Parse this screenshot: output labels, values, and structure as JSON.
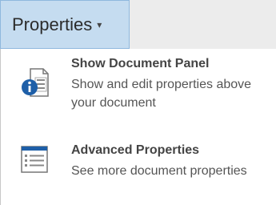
{
  "dropdown": {
    "label": "Properties",
    "caret_icon": "chevron-down-icon"
  },
  "menu": {
    "items": [
      {
        "title": "Show Document Panel",
        "description": "Show and edit properties above your document",
        "icon": "document-panel-info-icon"
      },
      {
        "title": "Advanced Properties",
        "description": "See more document properties",
        "icon": "list-properties-icon"
      }
    ]
  },
  "colors": {
    "button_bg": "#c5dcf0",
    "button_border": "#8fb8de",
    "info_blue": "#1e5fa8",
    "menu_bg": "#ffffff"
  }
}
